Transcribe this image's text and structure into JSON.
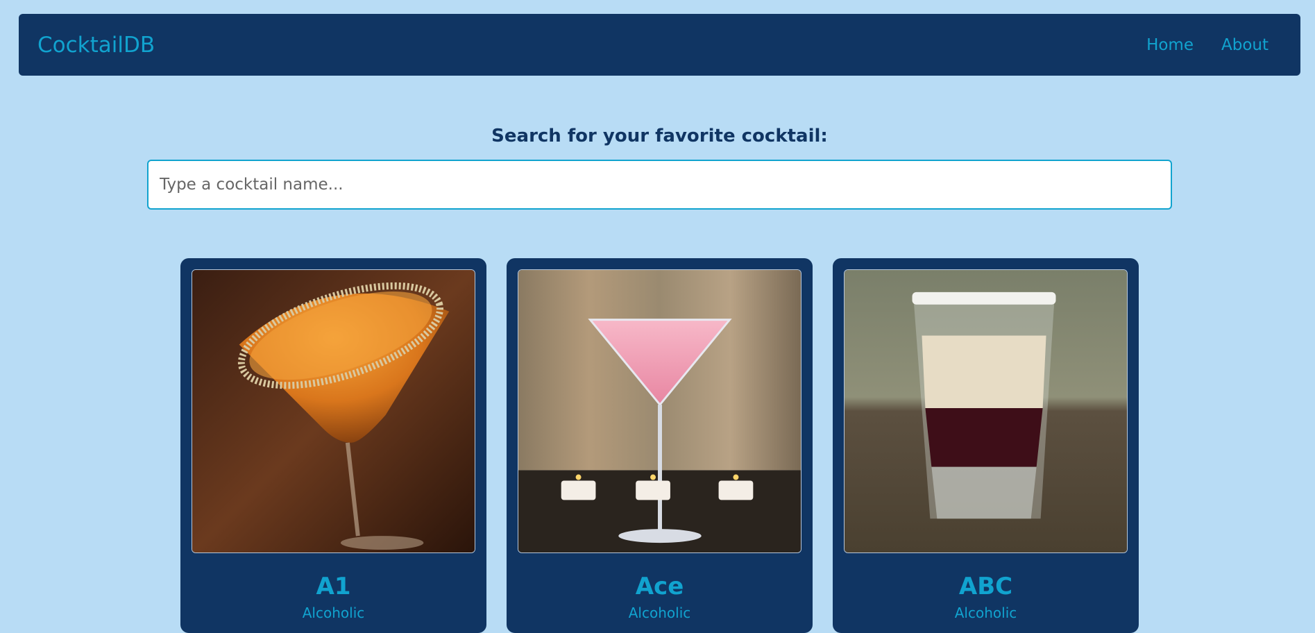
{
  "navbar": {
    "brand": "CocktailDB",
    "links": [
      {
        "label": "Home"
      },
      {
        "label": "About"
      }
    ]
  },
  "search": {
    "title": "Search for your favorite cocktail:",
    "placeholder": "Type a cocktail name...",
    "value": ""
  },
  "cards": [
    {
      "name": "A1",
      "type": "Alcoholic"
    },
    {
      "name": "Ace",
      "type": "Alcoholic"
    },
    {
      "name": "ABC",
      "type": "Alcoholic"
    }
  ]
}
